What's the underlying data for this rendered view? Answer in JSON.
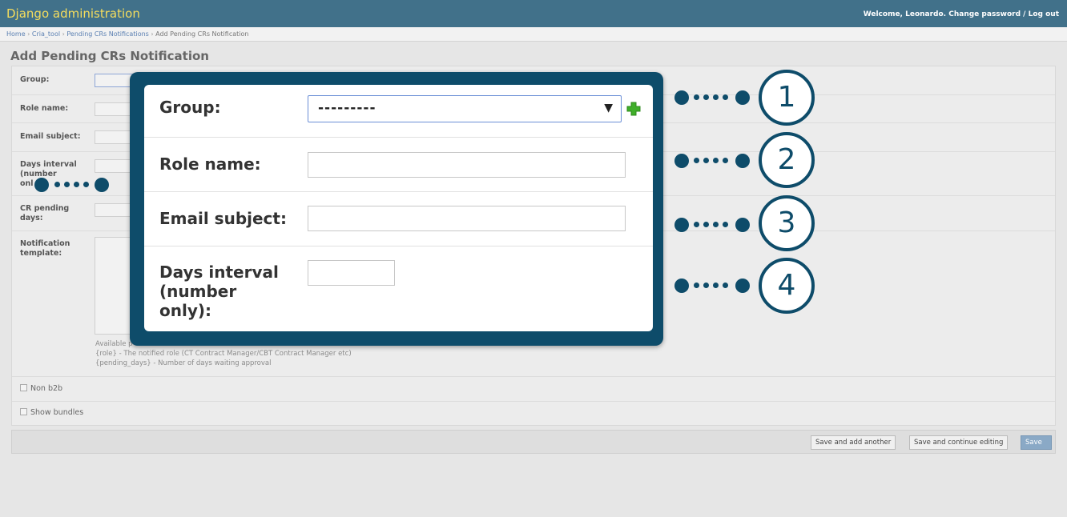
{
  "header": {
    "brand": "Django administration",
    "welcome": "Welcome,",
    "username": "Leonardo.",
    "change_password": "Change password",
    "separator": "/",
    "logout": "Log out"
  },
  "breadcrumbs": {
    "items": [
      "Home",
      "Cria_tool",
      "Pending CRs Notifications"
    ],
    "separator": "›",
    "current": "Add Pending CRs Notification"
  },
  "page": {
    "title": "Add Pending CRs Notification"
  },
  "background_form": {
    "group_label": "Group:",
    "role_label": "Role name:",
    "email_label": "Email subject:",
    "days_label_1": "Days interval",
    "days_label_2": "(number",
    "days_label_3": "onl",
    "pending_label_1": "CR pending",
    "pending_label_2": "days:",
    "template_label_1": "Notification",
    "template_label_2": "template:",
    "help_1": "Available p",
    "help_2": "{role} - The notified role (CT Contract Manager/CBT Contract Manager etc)",
    "help_3": "{pending_days} - Number of days waiting approval",
    "non_b2b": "Non b2b",
    "show_bundles": "Show bundles"
  },
  "submit_row": {
    "save_add_another": "Save and add another",
    "save_continue": "Save and continue editing",
    "save": "Save"
  },
  "zoom": {
    "group_label": "Group:",
    "group_selected": "---------",
    "role_label": "Role name:",
    "role_value": "",
    "email_label": "Email subject:",
    "email_value": "",
    "days_label_1": "Days interval",
    "days_label_2": "(number",
    "days_label_3": "only):",
    "days_value": ""
  },
  "callouts": [
    "1",
    "2",
    "3",
    "4"
  ],
  "colors": {
    "header_bg": "#41718a",
    "brand_text": "#f5dd5d",
    "callout": "#0e4c6a",
    "add_icon": "#3fae29"
  }
}
